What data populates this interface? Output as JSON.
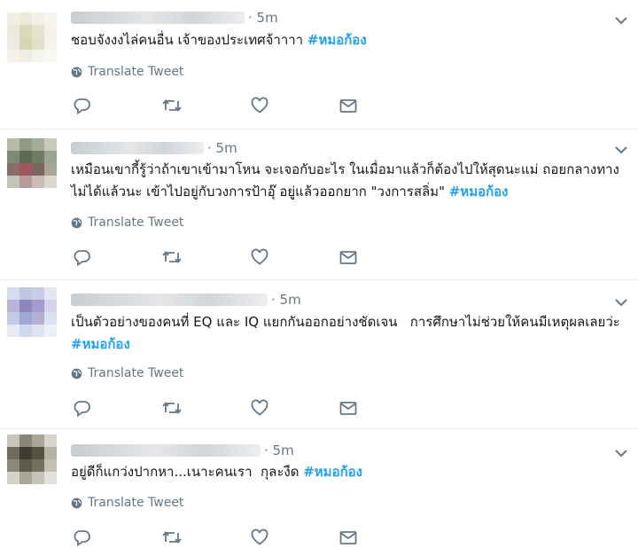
{
  "translate_label": "Translate Tweet",
  "hashtag": "#หมอก้อง",
  "colors": {
    "link": "#1da1f2",
    "muted": "#657786",
    "text": "#14171a",
    "divider": "#e6ecf0"
  },
  "icons": [
    "globe-icon",
    "chevron-down-icon",
    "reply-icon",
    "retweet-icon",
    "like-icon",
    "direct-message-icon"
  ],
  "tweets": [
    {
      "time": "· 5m",
      "text": "ชอบจังงงไล่คนอื่น เจ้าของประเทศจ้าาาา ",
      "hashtag": "#หมอก้อง"
    },
    {
      "time": "· 5m",
      "text": "เหมือนเขากี้รู้ว่าถ้าเขาเข้ามาโหน จะเจอกับอะไร ในเมื่อมาแล้วก็ต้องไปให้สุดนะแม่ ถอยกลางทางไม่ได้แล้วนะ เข้าไปอยู่กับวงการป้าอุ๊ อยู่แล้วออกยาก \"วงการสลิ่ม\" ",
      "hashtag": "#หมอก้อง"
    },
    {
      "time": "· 5m",
      "text": "เป็นตัวอย่างของคนที่ EQ และ IQ แยกกันออกอย่างชัดเจน   การศึกษาไม่ช่วยให้คนมีเหตุผลเลยว่ะ ",
      "hashtag": "#หมอก้อง"
    },
    {
      "time": "· 5m",
      "text": "อยู่ดีก็แกว่งปากหา...เนาะคนเรา  กุละงืด ",
      "hashtag": "#หมอก้อง"
    }
  ]
}
